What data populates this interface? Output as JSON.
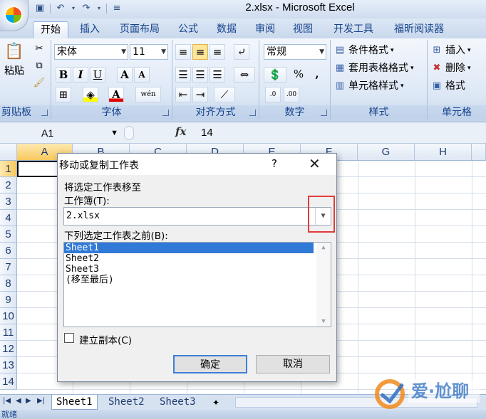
{
  "window": {
    "title": "2.xlsx - Microsoft Excel"
  },
  "qat": {
    "save_icon": "save-icon",
    "undo_icon": "undo-icon",
    "redo_icon": "redo-icon",
    "customize_icon": "customize-qat-icon"
  },
  "tabs": [
    {
      "label": "开始"
    },
    {
      "label": "插入"
    },
    {
      "label": "页面布局"
    },
    {
      "label": "公式"
    },
    {
      "label": "数据"
    },
    {
      "label": "审阅"
    },
    {
      "label": "视图"
    },
    {
      "label": "开发工具"
    },
    {
      "label": "福昕阅读器"
    }
  ],
  "ribbon": {
    "clipboard": {
      "label": "剪贴板",
      "paste": "粘贴"
    },
    "font": {
      "label": "字体",
      "name": "宋体",
      "size": "11",
      "bold": "B",
      "italic": "I",
      "underline": "U",
      "grow": "A",
      "shrink": "A",
      "wen": "wén"
    },
    "alignment": {
      "label": "对齐方式"
    },
    "number": {
      "label": "数字",
      "format": "常规",
      "percent": "%",
      "comma": ",",
      "inc_dec": ".0→.00",
      "dec_dec": ".00→.0"
    },
    "styles": {
      "label": "样式",
      "conditional": "条件格式",
      "table": "套用表格格式",
      "cell": "单元格样式"
    },
    "cells": {
      "label": "单元格",
      "insert": "插入",
      "delete": "删除",
      "format": "格式"
    }
  },
  "formula_bar": {
    "name_box": "A1",
    "fx": "fx",
    "value": "14"
  },
  "grid": {
    "columns": [
      "A",
      "B",
      "C",
      "D",
      "E",
      "F",
      "G",
      "H"
    ],
    "rows": [
      "1",
      "2",
      "3",
      "4",
      "5",
      "6",
      "7",
      "8",
      "9",
      "10",
      "11",
      "12",
      "13",
      "14"
    ]
  },
  "sheets": [
    {
      "label": "Sheet1"
    },
    {
      "label": "Sheet2"
    },
    {
      "label": "Sheet3"
    }
  ],
  "status": {
    "text": "就绪"
  },
  "dialog": {
    "title": "移动或复制工作表",
    "help": "?",
    "move_to_label": "将选定工作表移至",
    "workbook_label": "工作簿(T):",
    "workbook_value": "2.xlsx",
    "before_label": "下列选定工作表之前(B):",
    "sheets": [
      "Sheet1",
      "Sheet2",
      "Sheet3",
      "(移至最后)"
    ],
    "copy_label": "建立副本(C)",
    "ok": "确定",
    "cancel": "取消"
  },
  "colors": {
    "highlight_box": "#e23a3a",
    "selection": "#3179d6",
    "ribbon_text": "#15428b"
  }
}
